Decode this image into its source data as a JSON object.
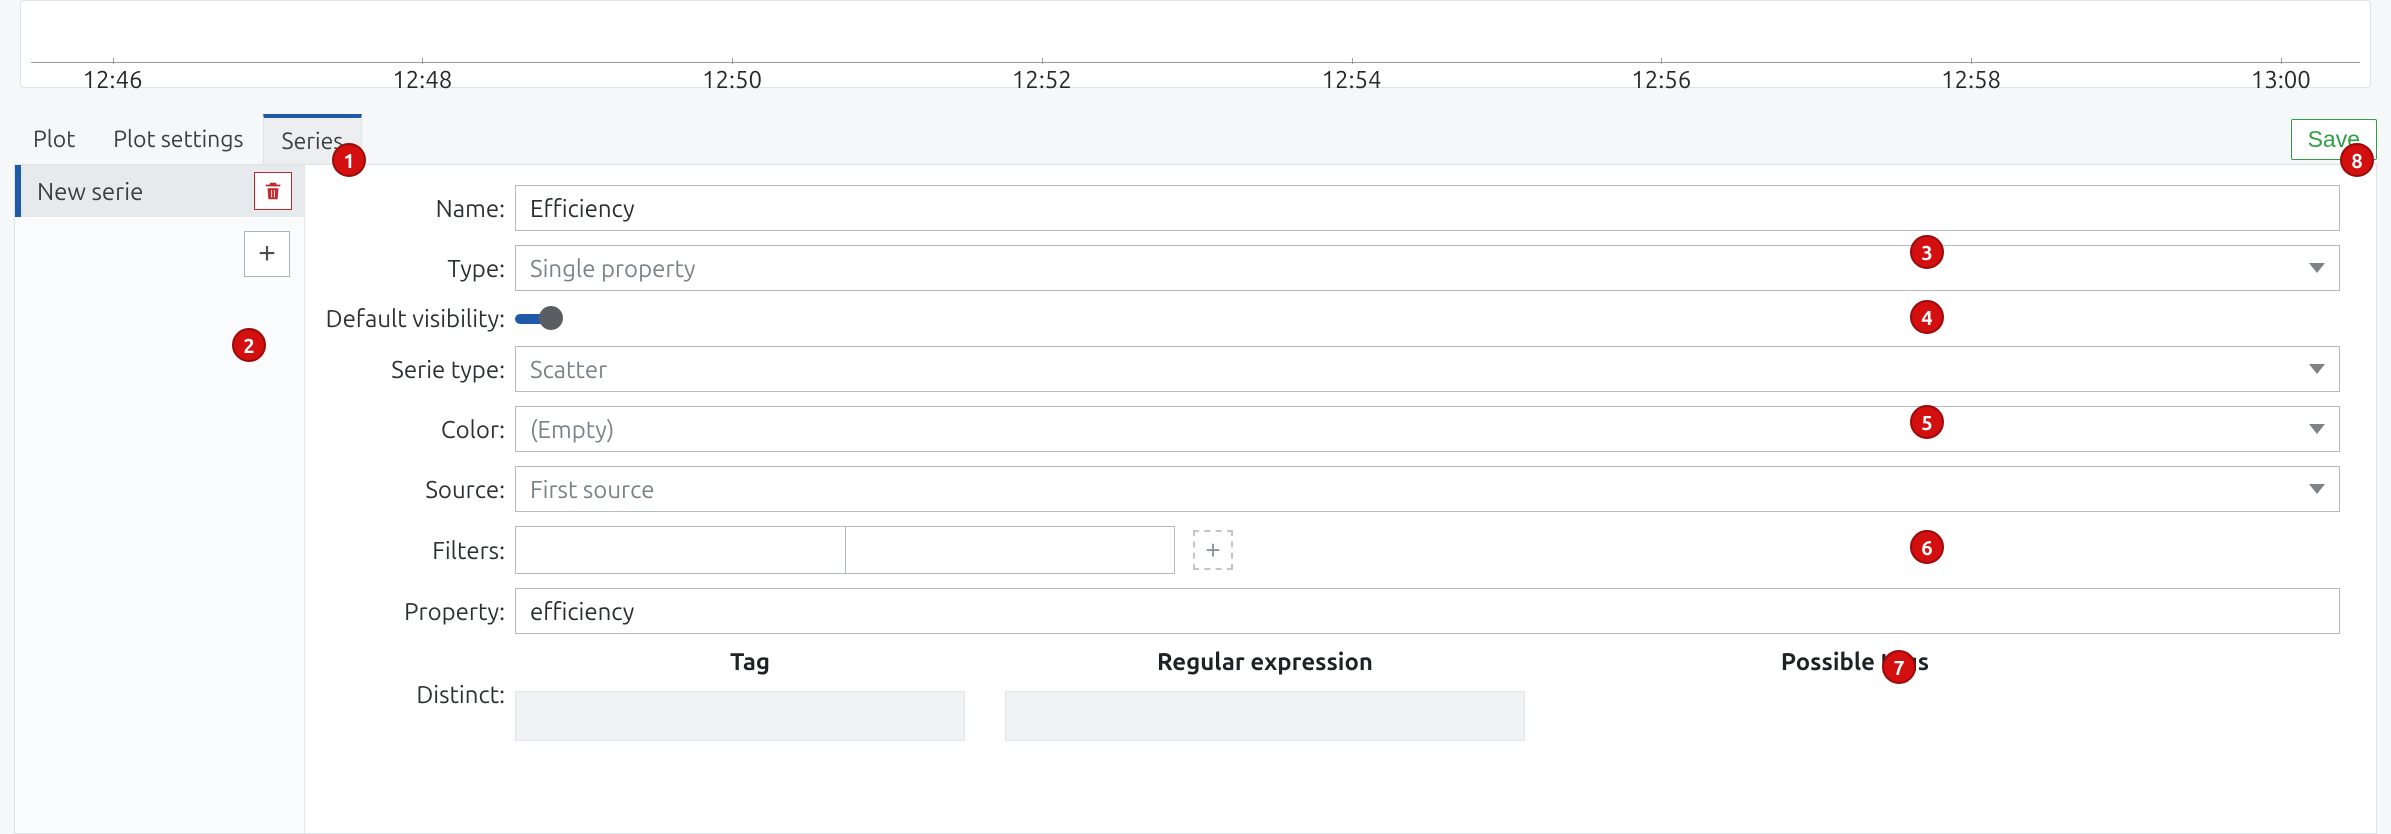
{
  "timeline": {
    "ticks": [
      "12:46",
      "12:48",
      "12:50",
      "12:52",
      "12:54",
      "12:56",
      "12:58",
      "13:00"
    ]
  },
  "tabs": {
    "plot": "Plot",
    "plot_settings": "Plot settings",
    "series": "Series"
  },
  "save_label": "Save",
  "sidebar": {
    "item_label": "New serie"
  },
  "form": {
    "name": {
      "label": "Name:",
      "value": "Efficiency"
    },
    "type": {
      "label": "Type:",
      "value": "Single property"
    },
    "visibility": {
      "label": "Default visibility:"
    },
    "serie_type": {
      "label": "Serie type:",
      "value": "Scatter"
    },
    "color": {
      "label": "Color:",
      "value": "(Empty)"
    },
    "source": {
      "label": "Source:",
      "value": "First source"
    },
    "filters": {
      "label": "Filters:"
    },
    "property": {
      "label": "Property:",
      "value": "efficiency"
    },
    "distinct": {
      "label": "Distinct:",
      "tag_header": "Tag",
      "regex_header": "Regular expression",
      "possible_header": "Possible tags"
    }
  },
  "annotations": {
    "1": "1",
    "2": "2",
    "3": "3",
    "4": "4",
    "5": "5",
    "6": "6",
    "7": "7",
    "8": "8"
  }
}
